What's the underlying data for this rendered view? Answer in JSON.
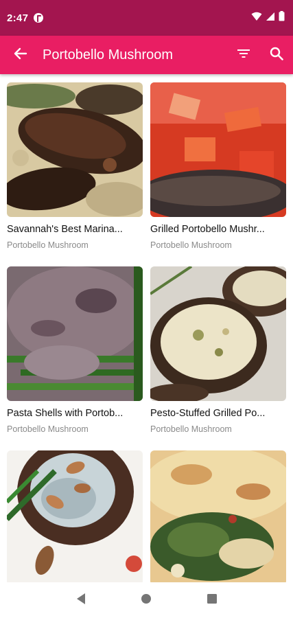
{
  "status_bar": {
    "time": "2:47",
    "icons": [
      "app-notification-icon",
      "wifi-icon",
      "signal-icon",
      "battery-icon"
    ]
  },
  "app_bar": {
    "title": "Portobello Mushroom",
    "icons": [
      "back-arrow-icon",
      "filter-icon",
      "search-icon"
    ],
    "color": "#e91e63",
    "status_color": "#a3154f"
  },
  "recipes": [
    {
      "title": "Savannah's Best Marina...",
      "category": "Portobello Mushroom"
    },
    {
      "title": "Grilled Portobello Mushr...",
      "category": "Portobello Mushroom"
    },
    {
      "title": "Pasta Shells with Portob...",
      "category": "Portobello Mushroom"
    },
    {
      "title": "Pesto-Stuffed Grilled Po...",
      "category": "Portobello Mushroom"
    },
    {
      "title": "",
      "category": ""
    },
    {
      "title": "",
      "category": ""
    }
  ],
  "nav_bar": {
    "icons": [
      "nav-back-icon",
      "nav-home-icon",
      "nav-recents-icon"
    ]
  }
}
